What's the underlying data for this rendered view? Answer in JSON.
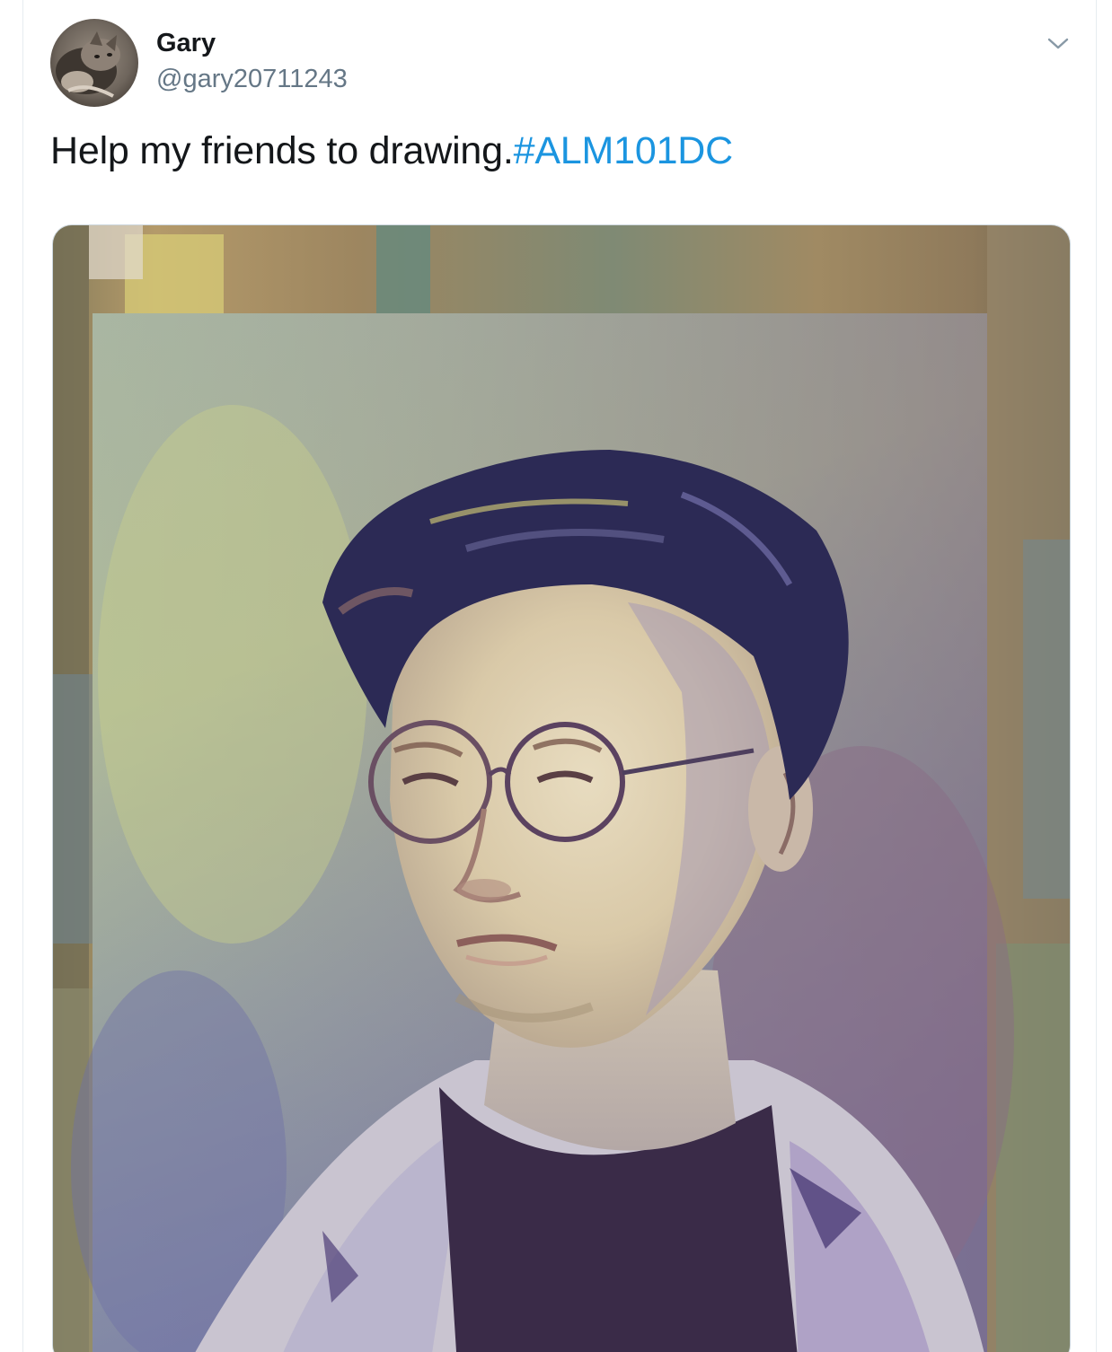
{
  "tweet": {
    "author": {
      "display_name": "Gary",
      "handle": "@gary20711243",
      "avatar_icon": "cat-avatar-icon"
    },
    "text": "Help my friends to drawing.",
    "hashtag": "#ALM101DC",
    "menu_icon": "chevron-down-icon",
    "media": {
      "kind": "photo",
      "subject": "oil-painting-portrait"
    }
  },
  "colors": {
    "text_primary": "#14171a",
    "text_secondary": "#657786",
    "link": "#1b95e0",
    "border": "#e6ecf0"
  }
}
